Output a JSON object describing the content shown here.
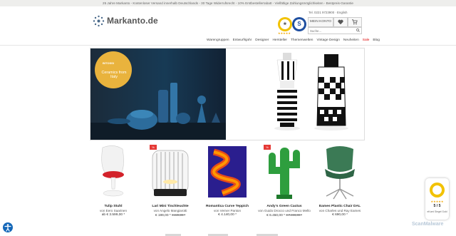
{
  "topbar": {
    "text": "25 Jahre Markanto - Kostenloser Versand innerhalb Deutschlands - 30 Tage Widerrufsrecht - 10% Erstbestellerrabatt - Vielfältige Zahlungsmöglichkeiten - Bestpreis-Garantie"
  },
  "header": {
    "logo_text": "Markanto.de",
    "contact": "Tel. 0221 9723900 · English",
    "account_label": "MEIN KONTO",
    "search_placeholder": "Suche...",
    "badge_shop_text": "★",
    "badge_stars": "★★★★★",
    "badge_trusted_text": "S"
  },
  "nav": {
    "items": [
      "Warengruppen",
      "Entwurfsjahr",
      "Designer",
      "Hersteller",
      "Themenwelten",
      "Vintage Design",
      "Neuheiten",
      "Sale",
      "Blog"
    ]
  },
  "hero": {
    "brand": "BITOSSI",
    "claim": "Ceramics from Italy"
  },
  "products": [
    {
      "name": "Tulip Stuhl",
      "designer": "von Eero Saarinen",
      "price": "ab € 3.599,00 *",
      "old_price": "",
      "sale": false
    },
    {
      "name": "Lari Mini Tischleuchte",
      "designer": "von Angelo Mangiarotti",
      "price": "€ 199,00 *",
      "old_price": "€ 249,00 *",
      "sale": true
    },
    {
      "name": "Romantica Curve Teppich",
      "designer": "von Verner Panton",
      "price": "€ 4.140,00 *",
      "old_price": "",
      "sale": false
    },
    {
      "name": "Andy's Green Cactus",
      "designer": "von Guido Drocco und Franco Mello",
      "price": "€ 6.450,00 *",
      "old_price": "€ 7.490,00 *",
      "sale": true
    },
    {
      "name": "Eames Plastic Chair DAL",
      "designer": "von Charles und Ray Eames",
      "price": "€ 690,00 *",
      "old_price": "",
      "sale": false
    }
  ],
  "sale_flag": "%",
  "trust_widget": {
    "stars": "★★★★★",
    "score": "5 / 5",
    "label": "eKomi Siegel Gold"
  },
  "watermark": "ScanMalware",
  "colors": {
    "topbar_bg": "#eeeeec",
    "sale_red": "#e53935",
    "hero_gold": "#e9b33d",
    "access_blue": "#1467b8"
  }
}
